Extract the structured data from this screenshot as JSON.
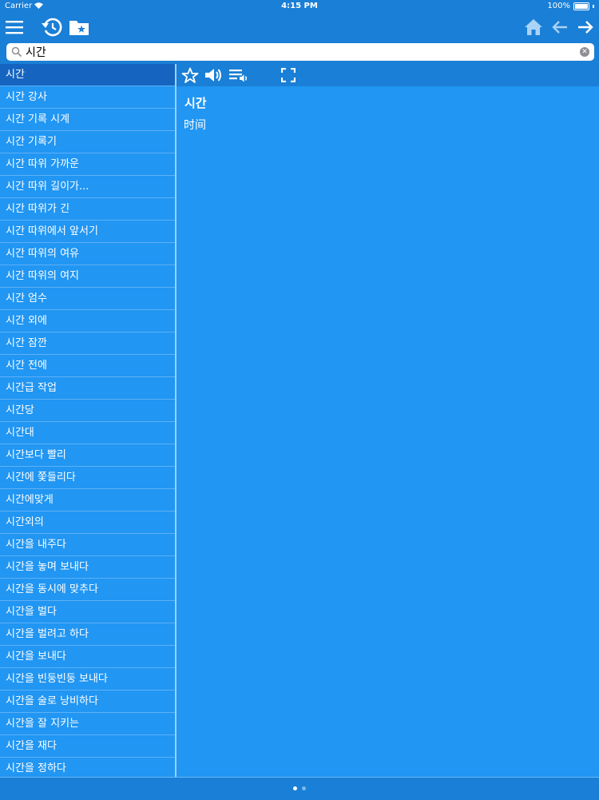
{
  "status_bar": {
    "carrier": "Carrier",
    "time": "4:15 PM",
    "battery": "100%"
  },
  "toolbar": {
    "left_icons": [
      "menu-icon",
      "history-icon",
      "favorites-folder-icon"
    ],
    "right_icons": [
      "home-icon",
      "back-arrow-icon",
      "forward-arrow-icon"
    ]
  },
  "search": {
    "query": "시간",
    "placeholder": ""
  },
  "word_list": [
    "시간",
    "시간 강사",
    "시간 기록 시계",
    "시간 기록기",
    "시간 따위 가까운",
    "시간 따위 길이가...",
    "시간 따위가 긴",
    "시간 따위에서 앞서기",
    "시간 따위의 여유",
    "시간 따위의 여지",
    "시간 엄수",
    "시간 외에",
    "시간 잠깐",
    "시간 전에",
    "시간급 작업",
    "시간당",
    "시간대",
    "시간보다 빨리",
    "시간에 쫓들리다",
    "시간에맞게",
    "시간외의",
    "시간을 내주다",
    "시간을 놓며 보내다",
    "시간을 동시에 맞추다",
    "시간을 벌다",
    "시간을 벌려고 하다",
    "시간을 보내다",
    "시간을 빈둥빈둥 보내다",
    "시간을 술로 낭비하다",
    "시간을 잘 지키는",
    "시간을 재다",
    "시간을 정하다"
  ],
  "selected_index": 0,
  "detail": {
    "toolbar_icons": [
      "star-icon",
      "speaker-icon",
      "playlist-audio-icon",
      "fullscreen-icon"
    ],
    "word": "시간",
    "translation": "时间"
  },
  "pager": {
    "pages": 2,
    "current": 0
  }
}
